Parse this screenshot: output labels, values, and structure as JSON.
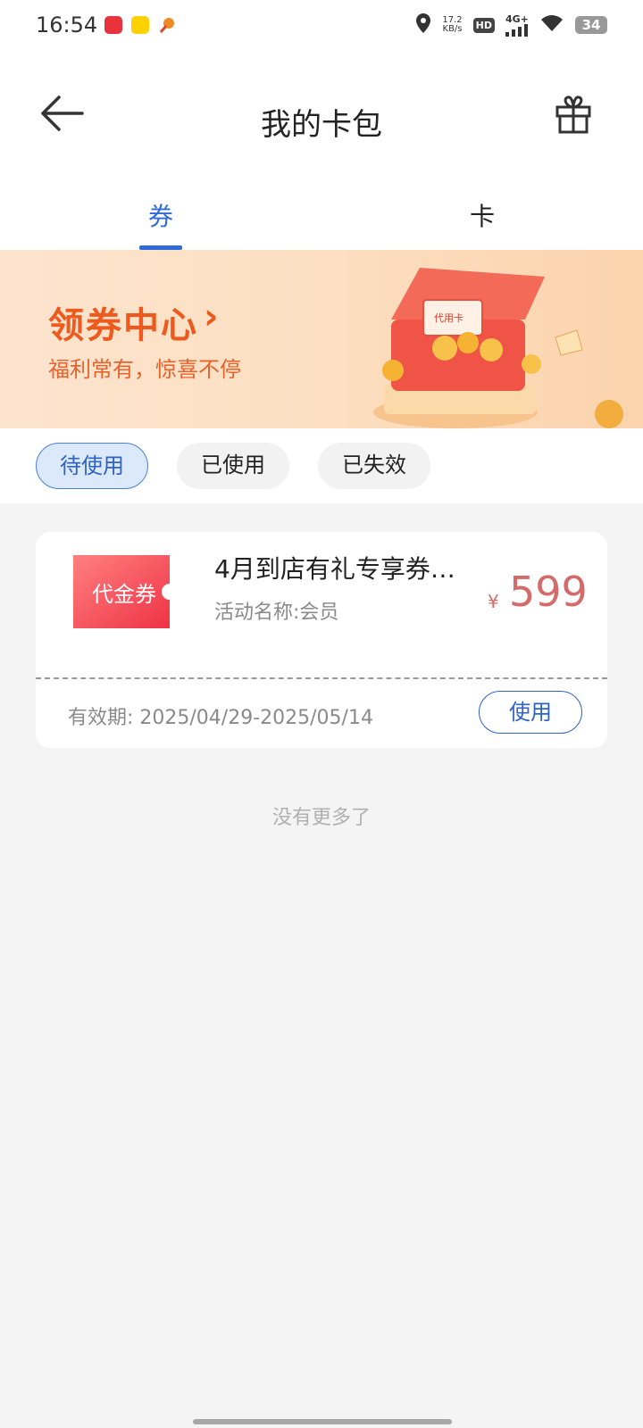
{
  "status_bar": {
    "time": "16:54",
    "net_speed_value": "17.2",
    "net_speed_unit": "KB/s",
    "hd": "HD",
    "network": "4G+",
    "battery": "34",
    "icons": [
      "app-red-icon",
      "meituan-icon",
      "app-orange-icon",
      "location-icon",
      "signal-icon",
      "wifi-icon",
      "battery-icon"
    ]
  },
  "header": {
    "title": "我的卡包",
    "back_icon": "back-arrow-icon",
    "gift_icon": "gift-icon"
  },
  "tabs": [
    {
      "label": "券",
      "active": true
    },
    {
      "label": "卡",
      "active": false
    }
  ],
  "banner": {
    "title": "领券中心",
    "arrow": "›",
    "subtitle": "福利常有，惊喜不停",
    "art_label": "代用卡"
  },
  "filters": [
    {
      "label": "待使用",
      "active": true
    },
    {
      "label": "已使用",
      "active": false
    },
    {
      "label": "已失效",
      "active": false
    }
  ],
  "coupon": {
    "badge": "代金券",
    "title": "4月到店有礼专享券…",
    "activity": "活动名称:会员",
    "currency": "¥",
    "amount": "599",
    "validity": "有效期: 2025/04/29-2025/05/14",
    "use_label": "使用"
  },
  "footer_note": "没有更多了",
  "colors": {
    "accent": "#2f6bd8",
    "price": "#d46a6a",
    "banner_text": "#ee5a1d",
    "badge": "#f2545b"
  }
}
